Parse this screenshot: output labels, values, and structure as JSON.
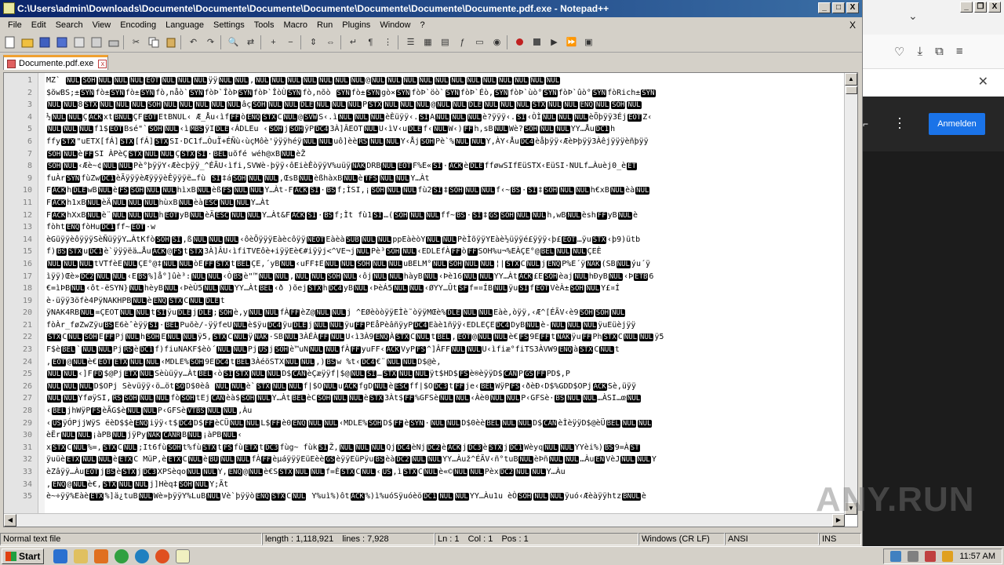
{
  "window": {
    "title": "C:\\Users\\admin\\Downloads\\Documente\\Documente\\Documente\\Documente\\Documente\\Documente\\Documente.pdf.exe - Notepad++",
    "btn_min": "_",
    "btn_max": "□",
    "btn_close": "X"
  },
  "menu": {
    "items": [
      "File",
      "Edit",
      "Search",
      "View",
      "Encoding",
      "Language",
      "Settings",
      "Tools",
      "Macro",
      "Run",
      "Plugins",
      "Window",
      "?"
    ],
    "close": "X"
  },
  "tab": {
    "label": "Documente.pdf.exe",
    "close": "x"
  },
  "editor": {
    "lines": [
      {
        "n": "1",
        "t": "MZ` [NUL][SOH][NUL][NUL][NUL][EOT][NUL][NUL][NUL]ÿÿ[NUL][NUL],[NUL][NUL][NUL][NUL][NUL][NUL][NUL]@[NUL][NUL][NUL][NUL][NUL][NUL][NUL][NUL][NUL][NUL][NUL][NUL]"
      },
      {
        "n": "2",
        "t": "$õwBS;±[SYN]fò±[SYN]fò±[SYN]fò,nåò`[SYN]fòÞ`ÎòÞ[SYN]fòÞ`ÎòÙ[SYN]fò,nõò [SYN]fò±[SYN]gò×[SYN]fòÞ`öò`[SYN]fòÞ`Éò,[SYN]fòÞ`ùò°[SYN]fòÞ`ûò°[SYN]fòRich±[SYN]"
      },
      {
        "n": "3",
        "t": "[NUL][NUL]8[STX][NUL][NUL][NUL][SOH][NUL][NUL][NUL][NUL][NUL]âç[SOH][NUL][NUL][DLE][NUL][NUL][NUL]P[STX][NUL][NUL][NUL]@[NUL][NUL][DLE][NUL][NUL][NUL][STX][NUL][NUL][ENQ][NUL][SOH][NUL]"
      },
      {
        "n": "4",
        "t": "½[NUL][NUL]Ç[ACK]xt[BNUL]ÇF[EOT]EtBNUL‹ Æ_Åu‹ìf[FF]ò[ENQ][STX]C[NUL]@[SVW]S‹.ì[NUL][NUL][NUL]èÈüÿÿ‹.[SI]A[NUL][NUL][NUL]è?ÿÿÿ‹.[SI]‹ÒÌ[NUL][NUL][NUL]èÕþÿÿ3Éj[EOT]Z‹"
      },
      {
        "n": "5",
        "t": "[NUL][NUL][NUL]f1$[EOT]Bsé\"`[SOH][NUL]‹ì[MBS]ÿI[DLE]‹ÁDLEu   ‹[SOH]j[SOH]ÿP[DC4]3À]ÂEOT[NUL]U‹ìV‹u[DLE]f‹[NUL]W‹)[FF]h,sB[NUL]Wè?[SOH][NUL][NUL]YY…Åu[DC1]h"
      },
      {
        "n": "6",
        "t": "ffy[STX]\"uETX[fÁ][STX][fÁ][STX]SI·DC1f…ÒuÏ+ÉÑù‹ùçMôè'ÿÿÿhéÿ[NUL][NUL]uô]èè[RS][NUL][NUL]Y‹Åj[SOH]Pè`%[NUL][NUL]Y,ÀY‹Åu[DC4]èåþÿÿ‹ÆèÞþÿÿ3Àêjÿÿÿèñþÿÿ"
      },
      {
        "n": "7",
        "t": "[SOH][NUL]è[FF]SI ÀPèÇ[STX][NUL][NUL]Ç[STX][SI]·[BEL]uõfé wéh@xB[NUL]èŽ"
      },
      {
        "n": "8",
        "t": "[SOH][NUL]‹Æè~¢[NUL][NUL]Pè°þÿÿY‹Æècþÿÿ_^ÉÃU‹ìfi,SVWè-þÿÿ‹ôEièÊòÿÿV%uüÿ[NAK]DRB[NUL][EOT]F%E«[SI]·[ACK]è[DLE]fføwSIfEüSTX‹EüSI·NULf…Àuèj0_è[ET]"
      },
      {
        "n": "9",
        "t": "fuÀr[SYN]fùZw[DC1]èÃÿÿÿèÆÿÿÿèÊÿÿÿë…fù [SI]‡á[SOH][NUL][NUL],ŒsB[NUL]èßhàxB[NUL]è[TFS][NUL][NUL]Y…Àt"
      },
      {
        "n": "10",
        "t": "F[ACK]h[DLE]wB[NUL]è[FS][SOH][NUL][NUL]hìxB[NUL]èß[FS][NUL][NUL]Y…Àt-F[ACK][SI]·[BS]f;ÌSI,¡[SOH][NUL][NUL]fù2[SI]‡[SOH][NUL][NUL]f‹~[BS]·[SI]‡[SOH][NUL][NUL]h€xB[NUL]èà[NUL]"
      },
      {
        "n": "11",
        "t": "F[ACK]h1xB[NUL]èÄ[NUL][NUL][NUL]hùxB[NUL]èà[ESC][NUL][NUL]Y…Àt"
      },
      {
        "n": "12",
        "t": "F[ACK]hXxB[NUL]è¨[NUL][NUL][NUL]h[EOT]yB[NUL]èÄ[ESC][NUL][NUL]Y…Àt&F[ACK][SI]·[BS]f;Ìt   fù1[SI]…([SOH][NUL][NUL]ff~[BS]·[SI]‡[GS][SOH][NUL][NUL]h,wB[NUL]èsh[FF]yB[NUL]è"
      },
      {
        "n": "13",
        "t": "fòht[ENQ]fòHu[DC1]ff~[EOT]·w"
      },
      {
        "n": "14",
        "t": "èGüÿÿèôÿÿÿSèÑüÿÿY…ÀtKfò[SOH][SI]‚ß[NUL][NUL][NUL]‹ôèÕÿÿÿEàècôÿÿ[NEOT]Eàèà[SUB][NUL][NUL]ppEàèòY[NUL][NUL]PèÌõÿÿYEàè½üÿÿé£ÿÿÿ‹þ£[EOT]…ÿu[STX]‹þ9)ütb"
      },
      {
        "n": "15",
        "t": "f)[BS][STX]u[DC1]è`ÿÿÿëä…Åu[ACK]@[FS]t[STX]3À]ÂU‹ìfiTVEôè+iÿÿEè€#iÿÿj<^VE¬j[NUL]Pè³[SOH][NUL]‹EDLEfÀ[FF]ò[FF]SOH%u¬%EÀÇE°@[BEL][NUL][NUL]ÇEÈ"
      },
      {
        "n": "16",
        "t": "[NUL][NUL][NUL]tVTfèE[NUL]ÇE°@‡[NUL][NUL]òE[FF][STX]t[BEL]ÇE,´yB[NUL]‹uFF‡E[NUL][NUL][SOH][NUL][NUL]uBELM°[NUL][SOH][NUL][NUL]¦|[STX]C[NUL]j[ENQ]P%E´ÿ[NAK](SB[NUL]ýu´ÿ"
      },
      {
        "n": "17",
        "t": "ìÿÿ)Œè»[DC2][NUL][NUL]‹E[BS]%]å°]ûè³:[NUL][NUL]‹Ò[BS]è\"™[NUL][NUL],[NUL][NUL][SOH][NUL]‹ôj[NUL][NUL]hàyB[NUL]‹Þè16[NUL][NUL]YY…Àt[ACK]£E[SOH]èaj[NUL]hÐyB[NUL]‹Þ[ETB]6"
      },
      {
        "n": "18",
        "t": "€=ìÞB[NUL]‹ôt-ëSYN}[NUL]hèyB[NUL]‹ÞèÙ5[NUL][NUL]YY…Àt[BEL]‹ð )õej[STX]h[DC4]yB[NUL]‹ÞèÁ5[NUL][NUL]‹ØYY…Ût[SF]f=¤ÍB[NUL]ÿu[SI]f[EOT]VèÀ±[SOH][NUL]Y£¤Í"
      },
      {
        "n": "19",
        "t": "è·üÿÿ3öfè4PÿNAKHPB[NUL]è[ENQ][STX]C[NUL][DLE]t"
      },
      {
        "n": "20",
        "t": "ÿNAK4RB[NUL]=ÇEOT[NUL][NUL]t[SI]ÿu[DLE]j[DLE];[SOH]è,y[NUL][NUL]fÀ[FF]èZ@[NUL][NUL]j   ^EØèòòÿÿEÌè˜òÿÿMŒè%[DLE][NUL][NUL]Eàè,òÿÿ,‹Æ^[ÉÃV‹è9[SOH][SOH][NUL]"
      },
      {
        "n": "21",
        "t": "fòÀr_føZwZÿu[BS]E6èˆèÿÿ[SI]·[BEL]Puõè/-ÿÿfeU[NUL]è$ÿu[DC4]ÿu[DLE]j[NUL][NUL]ÿu[FF]PEåPèâñÿyP[DC4]Eàè1ñÿÿ‹EDLEÇE[DC4]DyB[NUL]è-[NUL][NUL][NUL]ÿuEüèjÿÿ"
      },
      {
        "n": "22",
        "t": "[STX]C[NUL][SOH]E[FF]Pj[NUL]h[SOH]E[NUL][NUL]ÿ5,[STX]C[NUL]ÿ[NAK]·SB[NUL]3ÀÉÀ[FF][NUL]U‹ì3À9[ENQ]À[STX]C[NUL]t[BEL],[EOT]@[NUL][NUL]è€[FS]9E[FF]t[NAK]ÿu[FF]Ph[STX]C[NUL][NUL]ÿ5"
      },
      {
        "n": "23",
        "t": "F$è[BEL]`[NUL][NUL]Pj[RS]è[DC1]f)fiuNAKF$èò´[NUL][NUL]Pj[US]j[SOH]è™uN[NUL][NUL]fÀ[FF]yuFF‹[ACK]VyP[FS]^]ÂFF[NUL][NUL]U‹ìfiæ°fiTS3ÀVW9[ENQ]à[STX]C[NUL]t"
      },
      {
        "n": "24",
        "t": ",[EOT]@[NUL]è€[EOT][ETX][NUL][NUL]‹MDLE%[SOH]9E[DC4]t[BEL]3ÀéöSTX[NUL][NUL],)[BS]w %t‹[DC4]€¨[NUL][NUL]D$@è,"
      },
      {
        "n": "25",
        "t": "[NUL][NUL]‹]F[FD]$@Pj[ETX][NUL]Sèùüÿy…Àt[BEL]‹ò[SI][STX][NUL][NUL]D$[CAN]èÇæÿÿf|$@[NUL][SI]…[STX][NUL][NUL]ÿt$HD$[FS]è®èÿÿD$[CAN]P[GS][FF]PD$,P"
      },
      {
        "n": "26",
        "t": "[NUL][NUL][NUL]D$OPj    Sèvüÿÿ‹ö…öt[SO]D$0èâ [NUL][NUL]è`[STX][NUL][NUL]f|$O[NUL]u[ACK]fgD[NUL]è[ESC]ff|$O[DC3]t[FF]je‹[BEL]WÿP[FS]‹ðèÐ‹D$%GDD$OPj[ACK]Sè,üÿÿ"
      },
      {
        "n": "27",
        "t": "[NUL][NUL]YføÿSI,[RS][SOH][NUL][NUL]fò[SOH]tEj[CAN]èà$[SOH][NUL]Y…Àt[BEL]èC[SOH][NUL][NUL]è[STX]3Àt$[FF]%GFSè[NUL][NUL]‹Àè0[NUL][NUL]P‹GFSè·[BS][NUL][NUL]…ÀSI…œ[NUL]"
      },
      {
        "n": "28",
        "t": "‹[BEL]jhWÿP[FS]èÃG$è[NUL][NUL]P‹GFSè[VTBS][NUL][NUL],Àu"
      },
      {
        "n": "29",
        "t": "‹[US]ÿÓPjjWÿS ëèD$$è[ENQ]iÿÿ‹t$[DC4]D$[FF]èCÜ[NUL][NUL]L$[FF]è0[ENQ][NUL][NUL]‹MDLE%[SOH]D$[FF]è[SYN]·[NUL][NUL]D$0èè[BEL][NUL][NUL]D$[CAN]èÌèÿÿD$@èÜ[BEL][NUL][NUL]"
      },
      {
        "n": "30",
        "t": "èËr[NUL][NUL]¡àPB[NUL]jÿPy[NAK][CANR]B[NUL]¡àPB[NUL]‹"
      },
      {
        "n": "31",
        "t": "x[STX]C[NUL]%=,[STX]C[NUL];It6fù[SOH]t%fù[STX]t[FS]fù[ETX]t[DC3]fùg~   fùk[SI]Ž,[NUL][NUL][NUL]Qj[DC4]èNj[DC2]è[ACK]j[DC3]è[STX]j[DC1]Wèyq[NUL][NUL]YYèi%)[BS]9=À[ST]"
      },
      {
        "n": "32",
        "t": "ÿuüè[ETX][NUL][NUL]è[ETX]C MüP,è[ETX]C[NUL]è[BU][NUL][NUL]fÀ[FF]èµáÿÿÿEüEèè[GS]èÿÿEüPÿu[BS]èà[DC2][NUL][NUL]YY…Àuž^ÉÃV‹ñ°tuB[NUL]èÞñ[NUL][NUL]…Àu[EN]VèJ[NUL][NUL]Y"
      },
      {
        "n": "33",
        "t": "èZâÿÿ…Àu[EOT]j[BS]è[STX]j[DC3]XPSèqo[NUL][NUL]Y,[ENQ]@[NUL]è€S[STX][NUL][NUL]f=È[STX]C[NUL]‹[US],ì[STX]C[NUL]è«©[NUL][NUL]Pèx[DC2][NUL][NUL]Y…Àu"
      },
      {
        "n": "34",
        "t": ",[ENQ]@[NUL]è€,[STX][NUL][NUL]j]Hèq‡[SOH][NUL]Y;Ãt"
      },
      {
        "n": "35",
        "t": "è~÷ÿÿ%Eàè[ETX]%]ä¿tuB[NUL]Wè»þÿÿY%LuB[NUL]Vè`þÿÿò[ENQ][STX]C[NUL] Y%uì%)ôt[ACK]%)ì%uóSÿuóèö[DC1][NUL][NUL]YY…Àu1u èÒ[SOH][NUL][NUL]ÿuó‹Æèàÿÿhtz[BNUL]è"
      }
    ]
  },
  "status": {
    "type": "Normal text file",
    "length": "length : 1,118,921",
    "lines": "lines : 7,928",
    "ln": "Ln : 1",
    "col": "Col : 1",
    "pos": "Pos : 1",
    "eol": "Windows (CR LF)",
    "enc": "ANSI",
    "ins": "INS"
  },
  "browser": {
    "signin": "Anmelden",
    "close": "✕",
    "chevron": "⌄"
  },
  "taskbar": {
    "start": "Start",
    "time": "11:57 AM"
  },
  "watermark": "ANY.RUN"
}
